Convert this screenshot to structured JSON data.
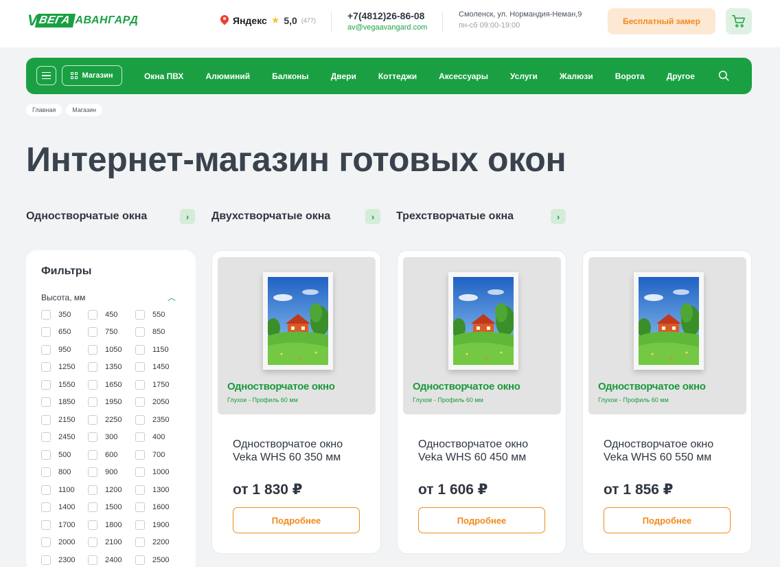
{
  "header": {
    "logo": {
      "vega": "ВЕГА",
      "avangard": "АВАНГАРД"
    },
    "yandex": {
      "name": "Яндекс",
      "rating": "5,0",
      "count": "(477)"
    },
    "phone": "+7(4812)26-86-08",
    "email": "av@vegaavangard.com",
    "address": "Смоленск, ул. Нормандия-Неман,9",
    "hours": "пн-сб 09:00-19:00",
    "measure_button": "Бесплатный замер"
  },
  "nav": {
    "shop_label": "Магазин",
    "items": [
      "Окна ПВХ",
      "Алюминий",
      "Балконы",
      "Двери",
      "Коттеджи",
      "Аксессуары",
      "Услуги",
      "Жалюзи",
      "Ворота",
      "Другое"
    ]
  },
  "breadcrumbs": [
    "Главная",
    "Магазин"
  ],
  "page_title": "Интернет-магазин готовых окон",
  "categories": [
    "Одностворчатые окна",
    "Двухстворчатые окна",
    "Трехстворчатые окна"
  ],
  "filters": {
    "title": "Фильтры",
    "group_title": "Высота, мм",
    "options": [
      "350",
      "450",
      "550",
      "650",
      "750",
      "850",
      "950",
      "1050",
      "1150",
      "1250",
      "1350",
      "1450",
      "1550",
      "1650",
      "1750",
      "1850",
      "1950",
      "2050",
      "2150",
      "2250",
      "2350",
      "2450",
      "300",
      "400",
      "500",
      "600",
      "700",
      "800",
      "900",
      "1000",
      "1100",
      "1200",
      "1300",
      "1400",
      "1500",
      "1600",
      "1700",
      "1800",
      "1900",
      "2000",
      "2100",
      "2200",
      "2300",
      "2400",
      "2500"
    ]
  },
  "products": [
    {
      "image_title": "Одностворчатое окно",
      "image_subtitle": "Глухое - Профиль 60 мм",
      "name": "Одностворчатое окно Veka WHS 60 350 мм",
      "price": "от 1 830 ₽",
      "button": "Подробнее"
    },
    {
      "image_title": "Одностворчатое окно",
      "image_subtitle": "Глухое - Профиль 60 мм",
      "name": "Одностворчатое окно Veka WHS 60 450 мм",
      "price": "от 1 606 ₽",
      "button": "Подробнее"
    },
    {
      "image_title": "Одностворчатое окно",
      "image_subtitle": "Глухое - Профиль 60 мм",
      "name": "Одностворчатое окно Veka WHS 60 550 мм",
      "price": "от 1 856 ₽",
      "button": "Подробнее"
    }
  ],
  "colors": {
    "brand_green": "#1aa043",
    "accent_orange": "#f08a1c"
  }
}
